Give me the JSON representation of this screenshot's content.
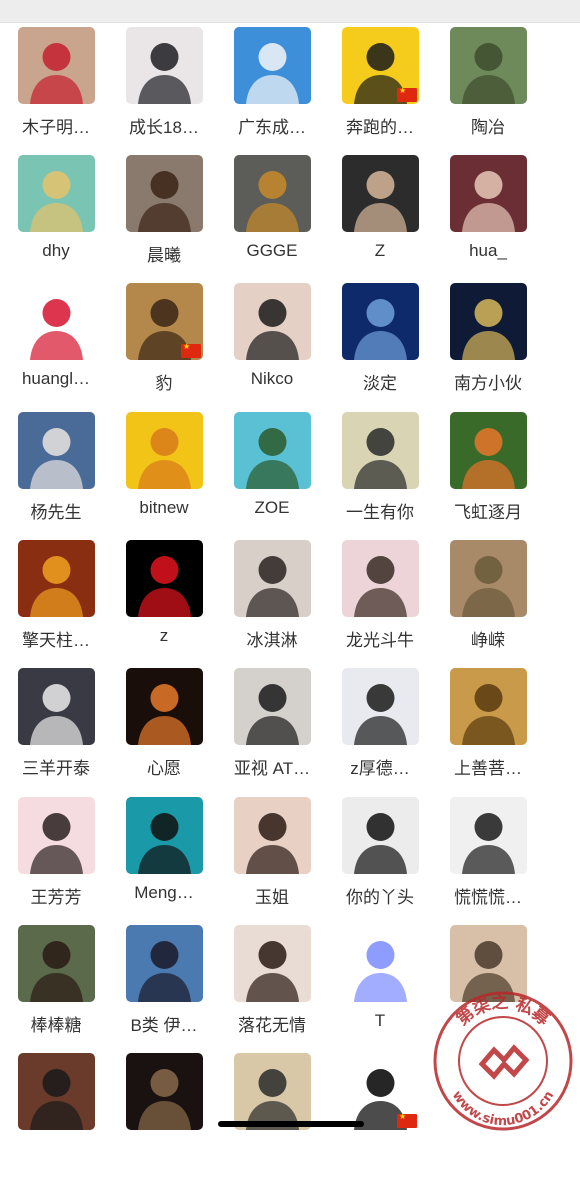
{
  "members": [
    {
      "name": "木子明…",
      "icon": "woman-red-top-avatar",
      "bg": "#c9a58e",
      "fg": "#c41e2e",
      "flag": false
    },
    {
      "name": "成长18…",
      "icon": "woman-black-dress-avatar",
      "bg": "#eae6e8",
      "fg": "#1c1c22",
      "flag": false
    },
    {
      "name": "广东成…",
      "icon": "blue-sky-cloud-avatar",
      "bg": "#3d8fd9",
      "fg": "#f4f6f8",
      "flag": false
    },
    {
      "name": "奔跑的…",
      "icon": "cartoon-bear-avatar",
      "bg": "#f5cc1c",
      "fg": "#1a1a1a",
      "flag": true
    },
    {
      "name": "陶冶",
      "icon": "tree-forest-avatar",
      "bg": "#6f8a5a",
      "fg": "#3e4c2e",
      "flag": false
    },
    {
      "name": "dhy",
      "icon": "tea-drinks-avatar",
      "bg": "#7ac4b4",
      "fg": "#e7c36a",
      "flag": false
    },
    {
      "name": "晨曦",
      "icon": "muscle-man-avatar",
      "bg": "#8a7a6e",
      "fg": "#3a2416",
      "flag": false
    },
    {
      "name": "GGGE",
      "icon": "motorcycle-rider-avatar",
      "bg": "#5c5c58",
      "fg": "#c88a2a",
      "flag": false
    },
    {
      "name": "Z",
      "icon": "man-portrait-avatar",
      "bg": "#2c2c2c",
      "fg": "#d7b69a",
      "flag": false
    },
    {
      "name": "hua_",
      "icon": "woman-dancing-avatar",
      "bg": "#6a2e34",
      "fg": "#e8c8b8",
      "flag": false
    },
    {
      "name": "huangl…",
      "icon": "red-h-logo-avatar",
      "bg": "#ffffff",
      "fg": "#d6122e",
      "flag": false
    },
    {
      "name": "豹",
      "icon": "leopard-avatar",
      "bg": "#b4884a",
      "fg": "#3a2616",
      "flag": true
    },
    {
      "name": "Nikco",
      "icon": "baby-sunglasses-avatar",
      "bg": "#e4d0c4",
      "fg": "#1a1a1a",
      "flag": false
    },
    {
      "name": "淡定",
      "icon": "night-moon-avatar",
      "bg": "#0e2a6a",
      "fg": "#6ea0d8",
      "flag": false
    },
    {
      "name": "南方小伙",
      "icon": "city-night-avatar",
      "bg": "#0e1a36",
      "fg": "#d8b85a",
      "flag": false
    },
    {
      "name": "杨先生",
      "icon": "sunset-sky-avatar",
      "bg": "#4a6a98",
      "fg": "#e8e4e0",
      "flag": false
    },
    {
      "name": "bitnew",
      "icon": "sunrise-road-avatar",
      "bg": "#f2c418",
      "fg": "#d87a1a",
      "flag": false
    },
    {
      "name": "ZOE",
      "icon": "palm-beach-avatar",
      "bg": "#5ac0d4",
      "fg": "#2a5a2a",
      "flag": false
    },
    {
      "name": "一生有你",
      "icon": "child-photo-avatar",
      "bg": "#d8d4b4",
      "fg": "#2a2a2a",
      "flag": false
    },
    {
      "name": "飞虹逐月",
      "icon": "goldfish-avatar",
      "bg": "#3a6a2a",
      "fg": "#e8742a",
      "flag": false
    },
    {
      "name": "擎天柱…",
      "icon": "robot-fire-avatar",
      "bg": "#8a2e12",
      "fg": "#f0a020",
      "flag": false
    },
    {
      "name": "z",
      "icon": "yin-yang-avatar",
      "bg": "#000000",
      "fg": "#e2141e",
      "flag": false
    },
    {
      "name": "冰淇淋",
      "icon": "woman-long-hair-avatar",
      "bg": "#d8d0c8",
      "fg": "#2a2220",
      "flag": false
    },
    {
      "name": "龙光斗牛",
      "icon": "woman-white-dress-avatar",
      "bg": "#ecd4d8",
      "fg": "#3a2a24",
      "flag": false
    },
    {
      "name": "峥嵘",
      "icon": "great-wall-avatar",
      "bg": "#a88a68",
      "fg": "#6a5a3a",
      "flag": false
    },
    {
      "name": "三羊开泰",
      "icon": "astronaut-avatar",
      "bg": "#3a3a44",
      "fg": "#ececec",
      "flag": false
    },
    {
      "name": "心愿",
      "icon": "birthday-cake-avatar",
      "bg": "#1a0e0a",
      "fg": "#e87a2a",
      "flag": false
    },
    {
      "name": "亚视 AT…",
      "icon": "woman-sitting-avatar",
      "bg": "#d4d0cc",
      "fg": "#1a1a1a",
      "flag": false
    },
    {
      "name": "z厚德…",
      "icon": "man-suit-avatar",
      "bg": "#e8eaf0",
      "fg": "#1a1a1a",
      "flag": false
    },
    {
      "name": "上善菩…",
      "icon": "buddha-calligraphy-avatar",
      "bg": "#c89a4a",
      "fg": "#5a3a0e",
      "flag": false
    },
    {
      "name": "王芳芳",
      "icon": "woman-pink-frame-avatar",
      "bg": "#f4dce0",
      "fg": "#2a2020",
      "flag": false
    },
    {
      "name": "Meng…",
      "icon": "cartoon-boy-avatar",
      "bg": "#1a9aa8",
      "fg": "#111111",
      "flag": false
    },
    {
      "name": "玉姐",
      "icon": "woman-face-avatar",
      "bg": "#e8d0c4",
      "fg": "#2a1a14",
      "flag": false
    },
    {
      "name": "你的丫头",
      "icon": "woman-black-lace-avatar",
      "bg": "#ececec",
      "fg": "#111111",
      "flag": false
    },
    {
      "name": "慌慌慌…",
      "icon": "young-man-avatar",
      "bg": "#f0f0f0",
      "fg": "#1a1a1a",
      "flag": false
    },
    {
      "name": "棒棒糖",
      "icon": "woman-outdoor-avatar",
      "bg": "#5a6a4a",
      "fg": "#2a1a14",
      "flag": false
    },
    {
      "name": "B类 伊…",
      "icon": "woman-seaside-avatar",
      "bg": "#4a7ab0",
      "fg": "#1a1a2a",
      "flag": false
    },
    {
      "name": "落花无情",
      "icon": "woman-selfie-avatar",
      "bg": "#e8dcd4",
      "fg": "#2a1a14",
      "flag": false
    },
    {
      "name": "T",
      "icon": "gummy-bear-avatar",
      "bg": "#ffffff",
      "fg": "#7a8aff",
      "flag": false
    },
    {
      "name": "",
      "icon": "woman-kitchen-avatar",
      "bg": "#d8c0a8",
      "fg": "#4a3a2a",
      "flag": false
    },
    {
      "name": "",
      "icon": "man-portrait-avatar",
      "bg": "#6a3a2a",
      "fg": "#1a1a1a",
      "flag": false
    },
    {
      "name": "",
      "icon": "dark-room-avatar",
      "bg": "#1a1210",
      "fg": "#8a6a4a",
      "flag": false
    },
    {
      "name": "",
      "icon": "man-calligraphy-avatar",
      "bg": "#d8c8a8",
      "fg": "#2a2a2a",
      "flag": false
    },
    {
      "name": "",
      "icon": "buddha-character-avatar",
      "bg": "#ffffff",
      "fg": "#000000",
      "flag": true
    },
    {
      "name": "",
      "icon": "blank-avatar",
      "bg": "#ffffff",
      "fg": "#ffffff",
      "flag": false
    }
  ],
  "watermark": {
    "text_top": "第柒之 私募",
    "text_bottom": "www.simu001.cn",
    "color": "#b8282a"
  },
  "colors": {
    "name_text": "#333333",
    "background": "#ffffff",
    "topbar": "#ededed"
  }
}
